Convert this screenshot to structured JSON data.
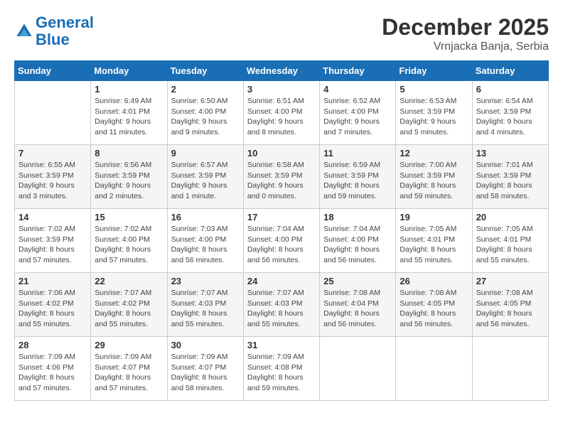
{
  "logo": {
    "line1": "General",
    "line2": "Blue"
  },
  "title": "December 2025",
  "subtitle": "Vrnjacka Banja, Serbia",
  "weekdays": [
    "Sunday",
    "Monday",
    "Tuesday",
    "Wednesday",
    "Thursday",
    "Friday",
    "Saturday"
  ],
  "weeks": [
    [
      {
        "day": "",
        "info": ""
      },
      {
        "day": "1",
        "info": "Sunrise: 6:49 AM\nSunset: 4:01 PM\nDaylight: 9 hours\nand 11 minutes."
      },
      {
        "day": "2",
        "info": "Sunrise: 6:50 AM\nSunset: 4:00 PM\nDaylight: 9 hours\nand 9 minutes."
      },
      {
        "day": "3",
        "info": "Sunrise: 6:51 AM\nSunset: 4:00 PM\nDaylight: 9 hours\nand 8 minutes."
      },
      {
        "day": "4",
        "info": "Sunrise: 6:52 AM\nSunset: 4:00 PM\nDaylight: 9 hours\nand 7 minutes."
      },
      {
        "day": "5",
        "info": "Sunrise: 6:53 AM\nSunset: 3:59 PM\nDaylight: 9 hours\nand 5 minutes."
      },
      {
        "day": "6",
        "info": "Sunrise: 6:54 AM\nSunset: 3:59 PM\nDaylight: 9 hours\nand 4 minutes."
      }
    ],
    [
      {
        "day": "7",
        "info": "Sunrise: 6:55 AM\nSunset: 3:59 PM\nDaylight: 9 hours\nand 3 minutes."
      },
      {
        "day": "8",
        "info": "Sunrise: 6:56 AM\nSunset: 3:59 PM\nDaylight: 9 hours\nand 2 minutes."
      },
      {
        "day": "9",
        "info": "Sunrise: 6:57 AM\nSunset: 3:59 PM\nDaylight: 9 hours\nand 1 minute."
      },
      {
        "day": "10",
        "info": "Sunrise: 6:58 AM\nSunset: 3:59 PM\nDaylight: 9 hours\nand 0 minutes."
      },
      {
        "day": "11",
        "info": "Sunrise: 6:59 AM\nSunset: 3:59 PM\nDaylight: 8 hours\nand 59 minutes."
      },
      {
        "day": "12",
        "info": "Sunrise: 7:00 AM\nSunset: 3:59 PM\nDaylight: 8 hours\nand 59 minutes."
      },
      {
        "day": "13",
        "info": "Sunrise: 7:01 AM\nSunset: 3:59 PM\nDaylight: 8 hours\nand 58 minutes."
      }
    ],
    [
      {
        "day": "14",
        "info": "Sunrise: 7:02 AM\nSunset: 3:59 PM\nDaylight: 8 hours\nand 57 minutes."
      },
      {
        "day": "15",
        "info": "Sunrise: 7:02 AM\nSunset: 4:00 PM\nDaylight: 8 hours\nand 57 minutes."
      },
      {
        "day": "16",
        "info": "Sunrise: 7:03 AM\nSunset: 4:00 PM\nDaylight: 8 hours\nand 56 minutes."
      },
      {
        "day": "17",
        "info": "Sunrise: 7:04 AM\nSunset: 4:00 PM\nDaylight: 8 hours\nand 56 minutes."
      },
      {
        "day": "18",
        "info": "Sunrise: 7:04 AM\nSunset: 4:00 PM\nDaylight: 8 hours\nand 56 minutes."
      },
      {
        "day": "19",
        "info": "Sunrise: 7:05 AM\nSunset: 4:01 PM\nDaylight: 8 hours\nand 55 minutes."
      },
      {
        "day": "20",
        "info": "Sunrise: 7:05 AM\nSunset: 4:01 PM\nDaylight: 8 hours\nand 55 minutes."
      }
    ],
    [
      {
        "day": "21",
        "info": "Sunrise: 7:06 AM\nSunset: 4:02 PM\nDaylight: 8 hours\nand 55 minutes."
      },
      {
        "day": "22",
        "info": "Sunrise: 7:07 AM\nSunset: 4:02 PM\nDaylight: 8 hours\nand 55 minutes."
      },
      {
        "day": "23",
        "info": "Sunrise: 7:07 AM\nSunset: 4:03 PM\nDaylight: 8 hours\nand 55 minutes."
      },
      {
        "day": "24",
        "info": "Sunrise: 7:07 AM\nSunset: 4:03 PM\nDaylight: 8 hours\nand 55 minutes."
      },
      {
        "day": "25",
        "info": "Sunrise: 7:08 AM\nSunset: 4:04 PM\nDaylight: 8 hours\nand 56 minutes."
      },
      {
        "day": "26",
        "info": "Sunrise: 7:08 AM\nSunset: 4:05 PM\nDaylight: 8 hours\nand 56 minutes."
      },
      {
        "day": "27",
        "info": "Sunrise: 7:08 AM\nSunset: 4:05 PM\nDaylight: 8 hours\nand 56 minutes."
      }
    ],
    [
      {
        "day": "28",
        "info": "Sunrise: 7:09 AM\nSunset: 4:06 PM\nDaylight: 8 hours\nand 57 minutes."
      },
      {
        "day": "29",
        "info": "Sunrise: 7:09 AM\nSunset: 4:07 PM\nDaylight: 8 hours\nand 57 minutes."
      },
      {
        "day": "30",
        "info": "Sunrise: 7:09 AM\nSunset: 4:07 PM\nDaylight: 8 hours\nand 58 minutes."
      },
      {
        "day": "31",
        "info": "Sunrise: 7:09 AM\nSunset: 4:08 PM\nDaylight: 8 hours\nand 59 minutes."
      },
      {
        "day": "",
        "info": ""
      },
      {
        "day": "",
        "info": ""
      },
      {
        "day": "",
        "info": ""
      }
    ]
  ]
}
